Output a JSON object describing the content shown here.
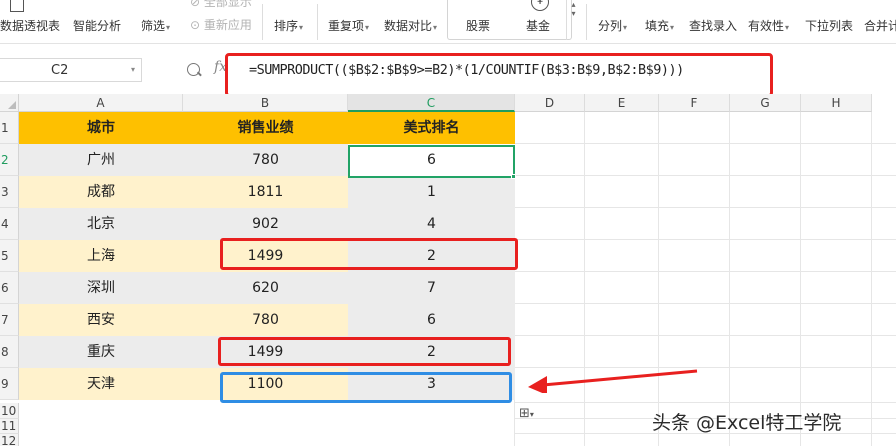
{
  "ribbon": {
    "pivot_table": "数据透视表",
    "smart_analysis": "智能分析",
    "filter": "筛选",
    "clear_all": "全部显示",
    "reapply": "重新应用",
    "sort": "排序",
    "duplicates": "重复项",
    "compare": "数据对比",
    "stock": "股票",
    "fund": "基金",
    "split": "分列",
    "fill": "填充",
    "lookup_entry": "查找录入",
    "validity": "有效性",
    "dropdown_list": "下拉列表",
    "consolidate": "合并计"
  },
  "formula_bar": {
    "name_box": "C2",
    "fx": "fx",
    "formula": "=SUMPRODUCT(($B$2:$B$9>=B2)*(1/COUNTIF(B$3:B$9,B$2:B$9)))"
  },
  "columns": [
    "A",
    "B",
    "C",
    "D",
    "E",
    "F",
    "G",
    "H"
  ],
  "rows": [
    "1",
    "2",
    "3",
    "4",
    "5",
    "6",
    "7",
    "8",
    "9",
    "10",
    "11",
    "12"
  ],
  "table": {
    "headers": [
      "城市",
      "销售业绩",
      "美式排名"
    ],
    "data": [
      [
        "广州",
        "780",
        "6"
      ],
      [
        "成都",
        "1811",
        "1"
      ],
      [
        "北京",
        "902",
        "4"
      ],
      [
        "上海",
        "1499",
        "2"
      ],
      [
        "深圳",
        "620",
        "7"
      ],
      [
        "西安",
        "780",
        "6"
      ],
      [
        "重庆",
        "1499",
        "2"
      ],
      [
        "天津",
        "1100",
        "3"
      ]
    ]
  },
  "colors": {
    "header_fill": "#fec000",
    "row_gray": "#ececec",
    "row_cream": "#fff2cc",
    "highlight_red": "#e8201f",
    "highlight_blue": "#2f8de4",
    "select_green": "#21a366"
  },
  "watermark": "头条 @Excel特工学院"
}
